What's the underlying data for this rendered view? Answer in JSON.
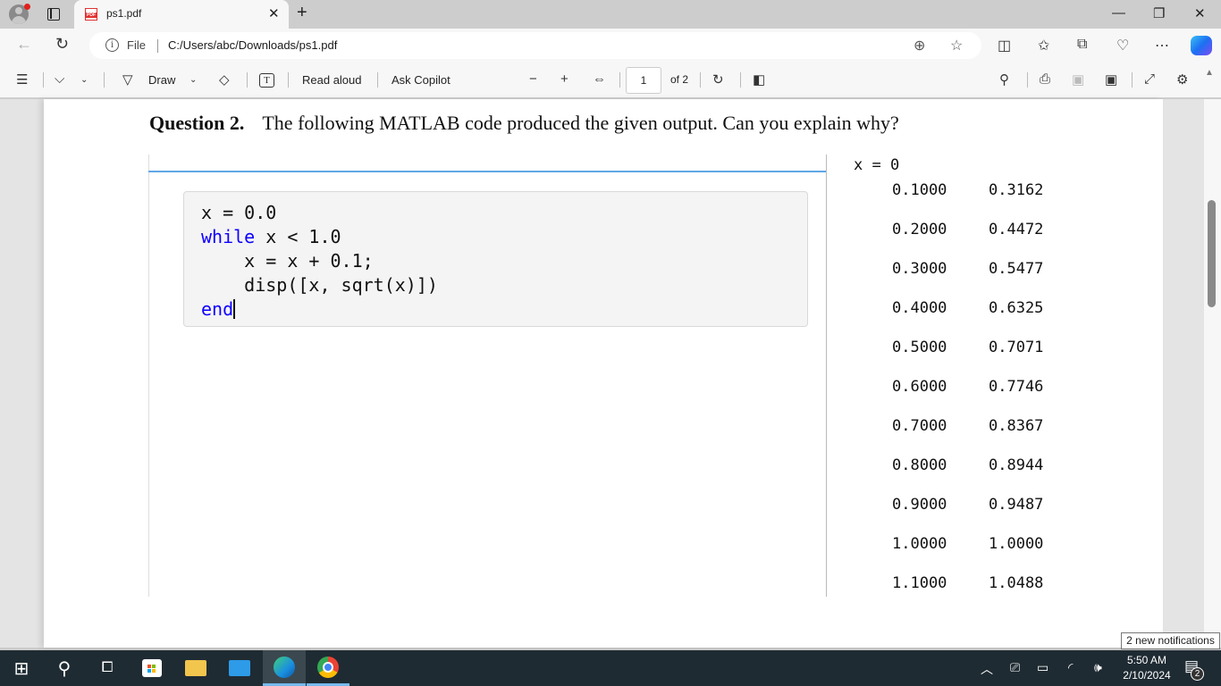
{
  "browser": {
    "tab_title": "ps1.pdf",
    "tab_icon_label": "PDF",
    "address_prefix": "File",
    "url": "C:/Users/abc/Downloads/ps1.pdf"
  },
  "pdf_toolbar": {
    "draw_label": "Draw",
    "read_aloud_label": "Read aloud",
    "ask_copilot_label": "Ask Copilot",
    "current_page": "1",
    "page_count": "of 2"
  },
  "document": {
    "question_label": "Question 2.",
    "question_text": "The following MATLAB code produced the given output. Can you explain why?",
    "code": {
      "line1": "x = 0.0",
      "line2_kw": "while",
      "line2_rest": " x < 1.0",
      "line3": "    x = x + 0.1;",
      "line4": "    disp([x, sqrt(x)])",
      "line5_kw": "end"
    },
    "output_header": "x = 0",
    "output_rows": [
      [
        "0.1000",
        "0.3162"
      ],
      [
        "0.2000",
        "0.4472"
      ],
      [
        "0.3000",
        "0.5477"
      ],
      [
        "0.4000",
        "0.6325"
      ],
      [
        "0.5000",
        "0.7071"
      ],
      [
        "0.6000",
        "0.7746"
      ],
      [
        "0.7000",
        "0.8367"
      ],
      [
        "0.8000",
        "0.8944"
      ],
      [
        "0.9000",
        "0.9487"
      ],
      [
        "1.0000",
        "1.0000"
      ],
      [
        "1.1000",
        "1.0488"
      ]
    ]
  },
  "taskbar": {
    "time": "5:50 AM",
    "date": "2/10/2024",
    "notification_tooltip": "2 new notifications",
    "notification_count": "2"
  }
}
